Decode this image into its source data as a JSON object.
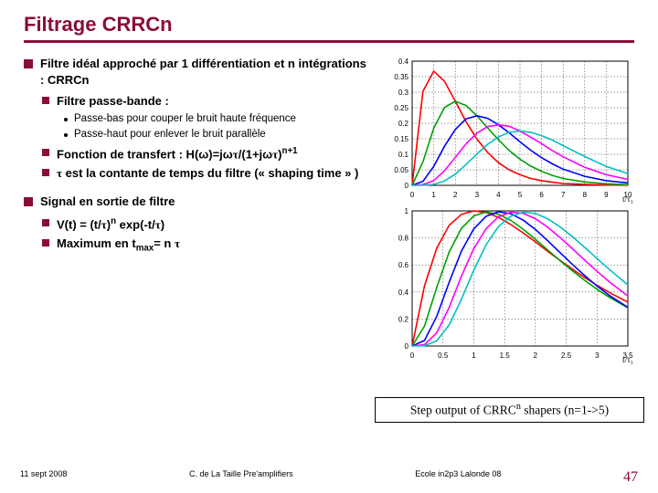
{
  "title": "Filtrage CRRCn",
  "section1": {
    "heading": "Filtre idéal approché par 1 différentiation et n intégrations : CRRCn",
    "sub1": "Filtre passe-bande :",
    "sub1a": "Passe-bas pour couper le bruit haute fréquence",
    "sub1b": "Passe-haut pour enlever le bruit parallèle",
    "sub2_pre": "Fonction de transfert : H(ω)=jω",
    "sub2_tau1": "τ",
    "sub2_mid": "/(1+jω",
    "sub2_tau2": "τ",
    "sub2_post1": ")",
    "sub2_exp": "n+1",
    "sub3_tau": "τ",
    "sub3_rest": " est la contante de temps du filtre (« shaping time » )"
  },
  "section2": {
    "heading": "Signal en sortie de filtre",
    "sub1_pre": "V(t) = (t/",
    "sub1_tau1": "τ",
    "sub1_mid": ")",
    "sub1_exp": "n",
    "sub1_post": " exp(-t/",
    "sub1_tau2": "τ",
    "sub1_end": ")",
    "sub2_pre": "Maximum en t",
    "sub2_sub": "max",
    "sub2_mid": "= n ",
    "sub2_tau": "τ"
  },
  "chart1": {
    "xlabel": "t/τ₁",
    "xticks": [
      0,
      1,
      2,
      3,
      4,
      5,
      6,
      7,
      8,
      9,
      10
    ],
    "yticks": [
      0,
      0.05,
      0.1,
      0.15,
      0.2,
      0.25,
      0.3,
      0.35,
      0.4
    ]
  },
  "chart2": {
    "xlabel": "t/τ₁",
    "xticks": [
      0,
      0.5,
      1,
      1.5,
      2,
      2.5,
      3,
      3.5
    ],
    "yticks": [
      0,
      0.2,
      0.4,
      0.6,
      0.8,
      1
    ]
  },
  "caption_pre": "Step output of CRRC",
  "caption_sup": "n",
  "caption_post": " shapers (n=1->5)",
  "footer": {
    "date": "11 sept 2008",
    "center": "C. de La Taille    Pre'amplifiers",
    "venue": "Ecole in2p3 Lalonde 08",
    "page": "47"
  },
  "chart_data": [
    {
      "type": "line",
      "title": "",
      "xlabel": "t/τ₁",
      "ylabel": "",
      "xlim": [
        0,
        10
      ],
      "ylim": [
        0,
        0.4
      ],
      "grid": true,
      "x": [
        0,
        0.5,
        1,
        1.5,
        2,
        2.5,
        3,
        3.5,
        4,
        4.5,
        5,
        5.5,
        6,
        6.5,
        7,
        8,
        9,
        10
      ],
      "series": [
        {
          "name": "n=1",
          "color": "#ff0000",
          "values": [
            0,
            0.303,
            0.368,
            0.335,
            0.271,
            0.205,
            0.149,
            0.106,
            0.073,
            0.05,
            0.034,
            0.022,
            0.015,
            0.01,
            0.006,
            0.003,
            0.001,
            0.0005
          ]
        },
        {
          "name": "n=2",
          "color": "#00a000",
          "values": [
            0,
            0.076,
            0.184,
            0.251,
            0.271,
            0.257,
            0.224,
            0.185,
            0.147,
            0.112,
            0.084,
            0.062,
            0.045,
            0.032,
            0.022,
            0.011,
            0.005,
            0.002
          ]
        },
        {
          "name": "n=3",
          "color": "#0000ff",
          "values": [
            0,
            0.013,
            0.061,
            0.126,
            0.18,
            0.214,
            0.224,
            0.216,
            0.195,
            0.169,
            0.14,
            0.113,
            0.089,
            0.069,
            0.052,
            0.029,
            0.015,
            0.008
          ]
        },
        {
          "name": "n=4",
          "color": "#ff00ff",
          "values": [
            0,
            0.002,
            0.015,
            0.047,
            0.09,
            0.134,
            0.168,
            0.189,
            0.195,
            0.19,
            0.175,
            0.155,
            0.134,
            0.112,
            0.092,
            0.058,
            0.034,
            0.019
          ]
        },
        {
          "name": "n=5",
          "color": "#00c0c0",
          "values": [
            0,
            0.0002,
            0.003,
            0.014,
            0.036,
            0.067,
            0.101,
            0.132,
            0.156,
            0.171,
            0.175,
            0.171,
            0.16,
            0.146,
            0.128,
            0.093,
            0.061,
            0.038
          ]
        }
      ]
    },
    {
      "type": "line",
      "title": "",
      "xlabel": "t/τ₁",
      "ylabel": "",
      "xlim": [
        0,
        3.5
      ],
      "ylim": [
        0,
        1
      ],
      "grid": true,
      "x": [
        0,
        0.2,
        0.4,
        0.6,
        0.8,
        1.0,
        1.2,
        1.4,
        1.6,
        1.8,
        2.0,
        2.2,
        2.4,
        2.6,
        2.8,
        3.0,
        3.2,
        3.5
      ],
      "series": [
        {
          "name": "n=1",
          "color": "#ff0000",
          "values": [
            0,
            0.445,
            0.726,
            0.893,
            0.974,
            1.0,
            0.988,
            0.952,
            0.899,
            0.837,
            0.77,
            0.701,
            0.634,
            0.569,
            0.507,
            0.449,
            0.396,
            0.325
          ]
        },
        {
          "name": "n=2",
          "color": "#00a000",
          "values": [
            0,
            0.147,
            0.436,
            0.696,
            0.871,
            0.963,
            0.992,
            0.976,
            0.93,
            0.865,
            0.79,
            0.711,
            0.632,
            0.557,
            0.486,
            0.42,
            0.36,
            0.284
          ]
        },
        {
          "name": "n=3",
          "color": "#0000ff",
          "values": [
            0,
            0.041,
            0.221,
            0.472,
            0.702,
            0.867,
            0.96,
            0.993,
            0.979,
            0.932,
            0.862,
            0.779,
            0.691,
            0.604,
            0.521,
            0.444,
            0.374,
            0.286
          ]
        },
        {
          "name": "n=4",
          "color": "#ff00ff",
          "values": [
            0,
            0.01,
            0.098,
            0.286,
            0.516,
            0.721,
            0.869,
            0.956,
            0.99,
            0.982,
            0.942,
            0.879,
            0.803,
            0.72,
            0.635,
            0.553,
            0.475,
            0.371
          ]
        },
        {
          "name": "n=5",
          "color": "#00c0c0",
          "values": [
            0,
            0.002,
            0.039,
            0.156,
            0.346,
            0.561,
            0.749,
            0.884,
            0.961,
            0.99,
            0.981,
            0.942,
            0.882,
            0.81,
            0.73,
            0.647,
            0.566,
            0.453
          ]
        }
      ]
    }
  ]
}
